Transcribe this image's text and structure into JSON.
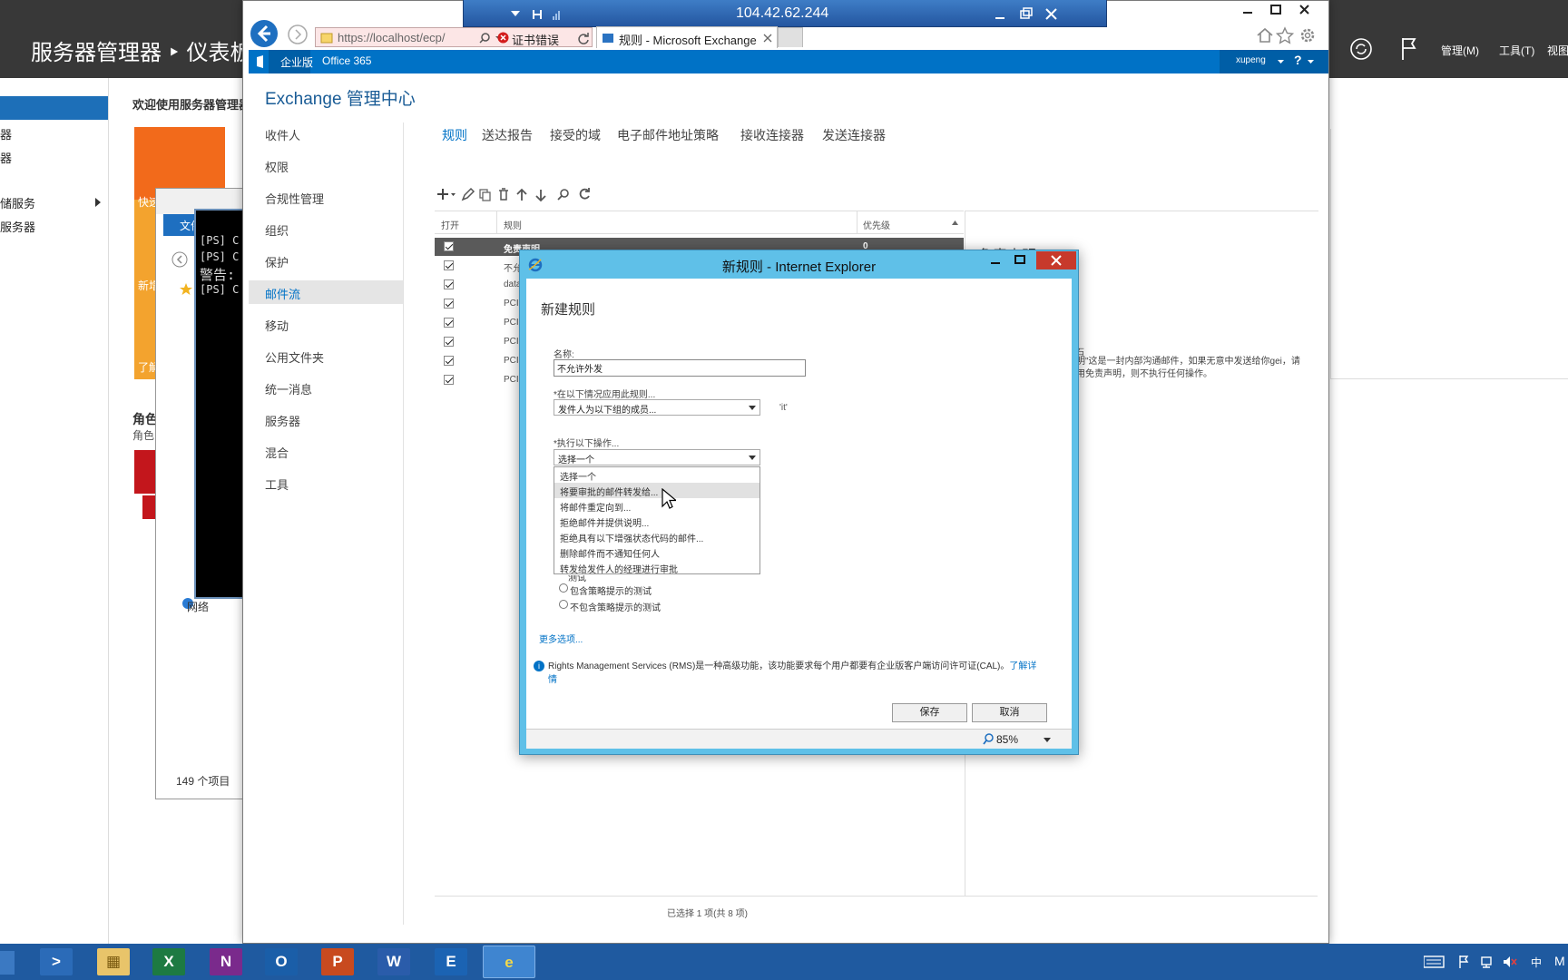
{
  "server_manager": {
    "title": "服务器管理器 ‣ 仪表板",
    "menus": [
      "管理(M)",
      "工具(T)",
      "视图"
    ],
    "nav_items": [
      "器",
      "器",
      "储服务",
      "服务器"
    ],
    "welcome": "欢迎使用服务器管理器",
    "tile_labels": [
      "快速",
      "新增",
      "了解"
    ],
    "role_title": "角色",
    "role_sub": "角色"
  },
  "explorer": {
    "menu": "文件",
    "network": "网络",
    "count": "149 个项目"
  },
  "powershell": {
    "lines": [
      "[PS] C",
      "[PS] C",
      "警告:",
      "[PS] C"
    ]
  },
  "rdp": {
    "ip": "104.42.62.244"
  },
  "ie": {
    "url": "https://localhost/ecp/",
    "cert_error": "证书错误",
    "tab_title": "规则 - Microsoft Exchange"
  },
  "eac": {
    "topbar": {
      "edition": "企业版",
      "office365": "Office 365",
      "user": "xupeng",
      "help": "?"
    },
    "title": "Exchange 管理中心",
    "left_nav": [
      "收件人",
      "权限",
      "合规性管理",
      "组织",
      "保护",
      "邮件流",
      "移动",
      "公用文件夹",
      "统一消息",
      "服务器",
      "混合",
      "工具"
    ],
    "left_nav_selected": 5,
    "sub_tabs": [
      "规则",
      "送达报告",
      "接受的域",
      "电子邮件地址策略",
      "接收连接器",
      "发送连接器"
    ],
    "sub_tab_selected": 0,
    "grid": {
      "headers": [
        "打开",
        "规则",
        "优先级"
      ],
      "rows": [
        {
          "rule": "免责声明",
          "priority": "0"
        },
        {
          "rule": "不允",
          "priority": ""
        },
        {
          "rule": "data",
          "priority": ""
        },
        {
          "rule": "PCI",
          "priority": ""
        },
        {
          "rule": "PCI",
          "priority": ""
        },
        {
          "rule": "PCI",
          "priority": ""
        },
        {
          "rule": "PCI",
          "priority": ""
        },
        {
          "rule": "PCI",
          "priority": ""
        }
      ]
    },
    "detail": {
      "title": "免责声明",
      "text_line1": "明\"这是一封内部沟通邮件，如果无意中发送给你gei，请",
      "text_line2": "用免责声明，则不执行任何操作。",
      "text_prefix": "石"
    },
    "footer": "已选择 1 项(共 8 项)"
  },
  "dialog": {
    "window_title": "新规则 - Internet Explorer",
    "heading": "新建规则",
    "name_label": "名称:",
    "name_value": "不允许外发",
    "condition_label": "*在以下情况应用此规则...",
    "condition_value": "发件人为以下组的成员...",
    "condition_add": "'it'",
    "action_label": "*执行以下操作...",
    "action_value": "选择一个",
    "action_options": [
      "选择一个",
      "将要审批的邮件转发给...",
      "将邮件重定向到...",
      "拒绝邮件并提供说明...",
      "拒绝具有以下增强状态代码的邮件...",
      "删除邮件而不通知任何人",
      "转发给发件人的经理进行审批"
    ],
    "action_highlighted": 1,
    "radio_partial": "测试",
    "radio_options": [
      "包含策略提示的测试",
      "不包含策略提示的测试"
    ],
    "more_options": "更多选项...",
    "info_text": "Rights Management Services (RMS)是一种高级功能，该功能要求每个用户都要有企业版客户端访问许可证(CAL)。",
    "info_link": "了解详",
    "info_link2": "情",
    "save": "保存",
    "cancel": "取消",
    "zoom": "85%"
  }
}
